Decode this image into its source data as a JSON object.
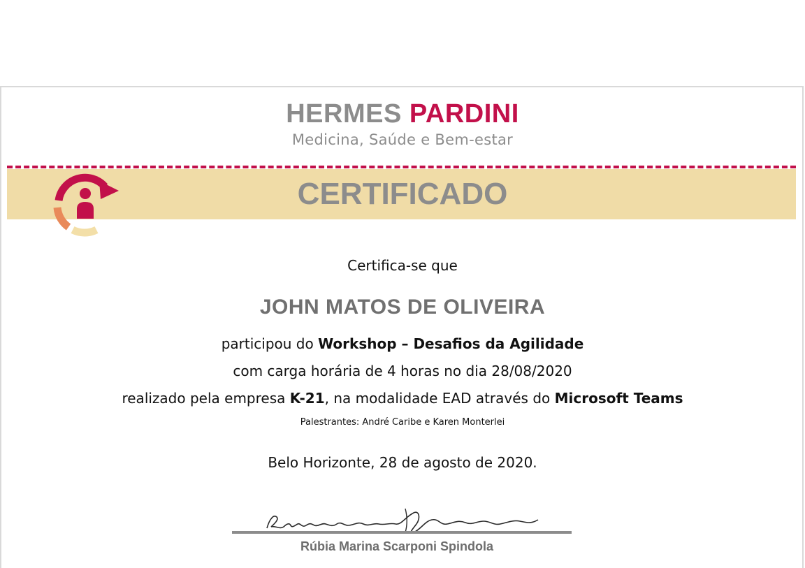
{
  "brand": {
    "name_part1": "HERMES",
    "name_part2": "PARDINI",
    "tagline": "Medicina, Saúde e Bem-estar"
  },
  "certificate": {
    "title": "CERTIFICADO",
    "intro": "Certifica-se que",
    "recipient": "JOHN MATOS DE OLIVEIRA",
    "line1_prefix": "participou do ",
    "line1_bold": "Workshop – Desafios da Agilidade",
    "line2": "com carga horária de 4 horas no dia 28/08/2020",
    "line3_prefix": "realizado pela empresa ",
    "line3_company": "K-21",
    "line3_middle": ", na modalidade EAD através do ",
    "line3_platform": "Microsoft Teams",
    "speakers": "Palestrantes: André Caribe e Karen Monterlei",
    "place_date": "Belo Horizonte, 28 de agosto de 2020."
  },
  "signature": {
    "handwritten": "Rúbia marina Spindola",
    "signer_name": "Rúbia Marina Scarponi Spindola"
  },
  "colors": {
    "brand_red": "#c2104a",
    "brand_gray": "#8c8c8c",
    "band_beige": "#f0dca7",
    "logo_orange": "#e98a5a"
  }
}
